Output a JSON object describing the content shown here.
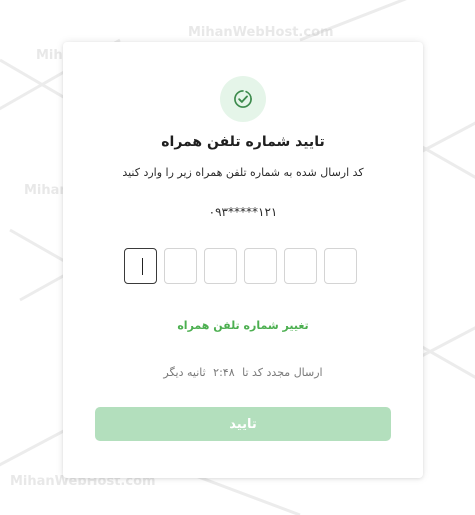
{
  "watermark": {
    "text": "MihanWebHost.com"
  },
  "verify": {
    "icon": "check-circle-icon",
    "title": "تایید شماره تلفن همراه",
    "subtitle": "کد ارسال شده به شماره تلفن همراه زیر را وارد کنید",
    "phone_masked": "۰۹۳*****۱۲۱",
    "otp_length": 6,
    "otp_values": [
      "",
      "",
      "",
      "",
      "",
      ""
    ],
    "change_phone_label": "تغییر شماره تلفن همراه",
    "resend_prefix": "ارسال مجدد کد تا",
    "resend_timer": "۲:۴۸",
    "resend_suffix": "ثانیه دیگر",
    "confirm_label": "تایید"
  },
  "colors": {
    "accent": "#4caf50",
    "button_disabled": "#b3dfbd",
    "badge_bg": "#e5f5e9"
  }
}
